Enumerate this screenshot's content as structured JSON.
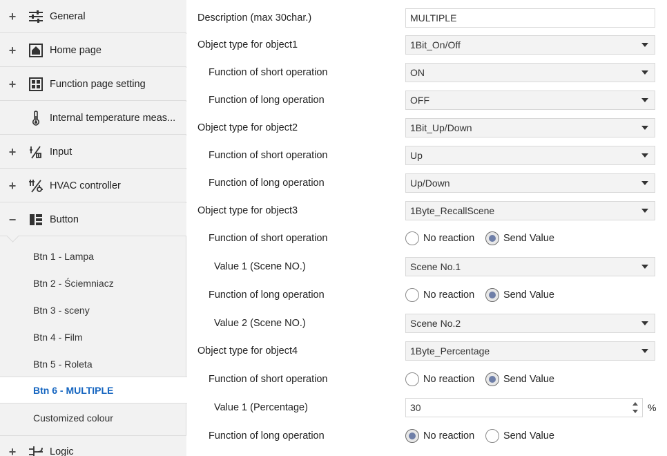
{
  "sidebar": {
    "items": [
      {
        "label": "General",
        "expander": "+",
        "icon": "sliders-icon"
      },
      {
        "label": "Home page",
        "expander": "+",
        "icon": "home-icon"
      },
      {
        "label": "Function page setting",
        "expander": "+",
        "icon": "grid-icon"
      },
      {
        "label": "Internal temperature meas...",
        "expander": "",
        "icon": "thermometer-icon"
      },
      {
        "label": "Input",
        "expander": "+",
        "icon": "input-icon"
      },
      {
        "label": "HVAC controller",
        "expander": "+",
        "icon": "hvac-icon"
      },
      {
        "label": "Button",
        "expander": "−",
        "icon": "button-panel-icon"
      }
    ],
    "sub_items": [
      {
        "label": "Btn 1 - Lampa"
      },
      {
        "label": "Btn 2 - Ściemniacz"
      },
      {
        "label": "Btn 3 - sceny"
      },
      {
        "label": "Btn 4 - Film"
      },
      {
        "label": "Btn 5 - Roleta"
      },
      {
        "label": "Btn 6 - MULTIPLE"
      },
      {
        "label": "Customized colour"
      }
    ],
    "logic": {
      "label": "Logic",
      "expander": "+",
      "icon": "logic-icon"
    }
  },
  "form": {
    "description": {
      "label": "Description (max 30char.)",
      "value": "MULTIPLE"
    },
    "object1": {
      "label": "Object type for object1",
      "value": "1Bit_On/Off"
    },
    "obj1_short": {
      "label": "Function of short operation",
      "value": "ON"
    },
    "obj1_long": {
      "label": "Function of long operation",
      "value": "OFF"
    },
    "object2": {
      "label": "Object type for object2",
      "value": "1Bit_Up/Down"
    },
    "obj2_short": {
      "label": "Function of short operation",
      "value": "Up"
    },
    "obj2_long": {
      "label": "Function of long operation",
      "value": "Up/Down"
    },
    "object3": {
      "label": "Object type for object3",
      "value": "1Byte_RecallScene"
    },
    "obj3_short": {
      "label": "Function of short operation",
      "option_a": "No reaction",
      "option_b": "Send Value",
      "selected": "Send Value"
    },
    "obj3_value1": {
      "label": "Value 1 (Scene NO.)",
      "value": "Scene No.1"
    },
    "obj3_long": {
      "label": "Function of long operation",
      "option_a": "No reaction",
      "option_b": "Send Value",
      "selected": "Send Value"
    },
    "obj3_value2": {
      "label": "Value 2 (Scene NO.)",
      "value": "Scene No.2"
    },
    "object4": {
      "label": "Object type for object4",
      "value": "1Byte_Percentage"
    },
    "obj4_short": {
      "label": "Function of short operation",
      "option_a": "No reaction",
      "option_b": "Send Value",
      "selected": "Send Value"
    },
    "obj4_value1": {
      "label": "Value 1 (Percentage)",
      "value": "30",
      "unit": "%"
    },
    "obj4_long": {
      "label": "Function of long operation",
      "option_a": "No reaction",
      "option_b": "Send Value",
      "selected": "No reaction"
    }
  }
}
